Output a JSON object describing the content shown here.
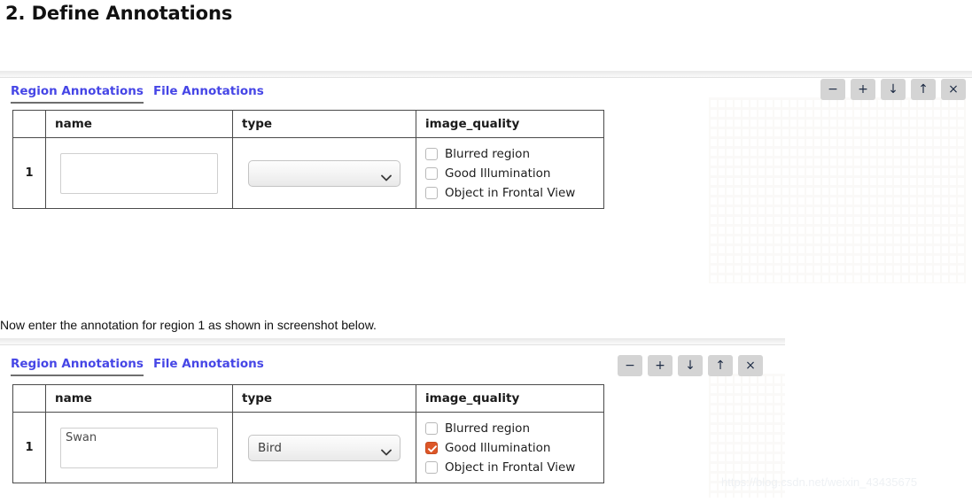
{
  "heading": "2. Define Annotations",
  "instruction": "Now enter the annotation for region 1 as shown in screenshot below.",
  "watermark": "https://blog.csdn.net/weixin_43435675",
  "colors": {
    "tab_link": "#4646e6",
    "checkbox_checked": "#dd5627",
    "toolbar_button": "#d4d4d4",
    "table_border": "#4a4a4a"
  },
  "tabs": [
    {
      "label": "Region Annotations",
      "active": true
    },
    {
      "label": "File Annotations",
      "active": false
    }
  ],
  "toolbar": [
    {
      "icon": "minus-icon",
      "glyph": "−",
      "title": "minus"
    },
    {
      "icon": "plus-icon",
      "glyph": "+",
      "title": "plus"
    },
    {
      "icon": "arrow-down-icon",
      "glyph": "↓",
      "title": "move down"
    },
    {
      "icon": "arrow-up-icon",
      "glyph": "↑",
      "title": "move up"
    },
    {
      "icon": "close-icon",
      "glyph": "×",
      "title": "close"
    }
  ],
  "table": {
    "headers": [
      "",
      "name",
      "type",
      "image_quality"
    ],
    "quality_options": [
      "Blurred region",
      "Good Illumination",
      "Object in Frontal View"
    ]
  },
  "panel_empty": {
    "row_index": "1",
    "name_value": "",
    "name_placeholder": "",
    "type_value": "",
    "quality_checked": [
      false,
      false,
      false
    ]
  },
  "panel_filled": {
    "row_index": "1",
    "name_value": "Swan",
    "name_placeholder": "",
    "type_value": "Bird",
    "quality_checked": [
      false,
      true,
      false
    ]
  }
}
